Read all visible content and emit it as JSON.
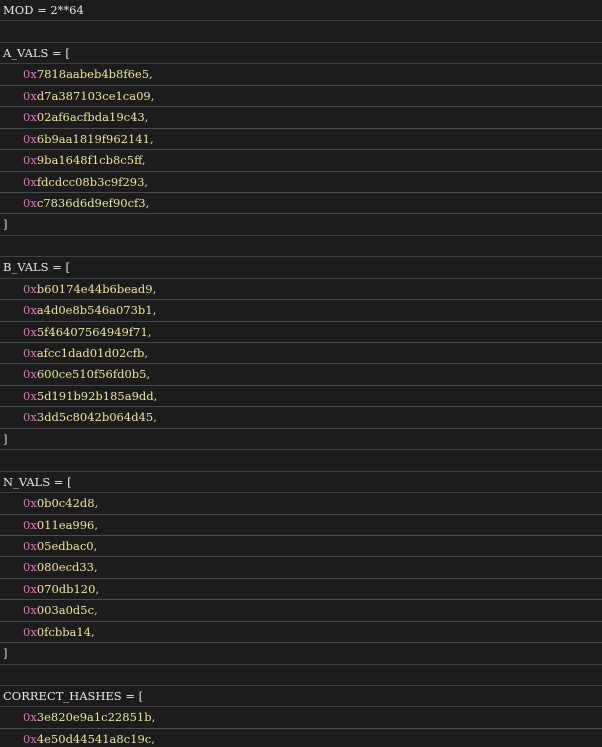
{
  "header": {
    "line": "MOD = 2**64"
  },
  "a_vals": {
    "open": "A_VALS = [",
    "items": [
      {
        "pre": "0x",
        "val": "7818aabeb4b8f6e5",
        "sep": ","
      },
      {
        "pre": "0x",
        "val": "d7a387103ce1ca09",
        "sep": ","
      },
      {
        "pre": "0x",
        "val": "02af6acfbda19c43",
        "sep": ","
      },
      {
        "pre": "0x",
        "val": "6b9aa1819f962141",
        "sep": ","
      },
      {
        "pre": "0x",
        "val": "9ba1648f1cb8c5ff",
        "sep": ","
      },
      {
        "pre": "0x",
        "val": "fdcdcc08b3c9f293",
        "sep": ","
      },
      {
        "pre": "0x",
        "val": "c7836d6d9ef90cf3",
        "sep": ","
      }
    ],
    "close": "]"
  },
  "b_vals": {
    "open": "B_VALS = [",
    "items": [
      {
        "pre": "0x",
        "val": "b60174e44b6bead9",
        "sep": ","
      },
      {
        "pre": "0x",
        "val": "a4d0e8b546a073b1",
        "sep": ","
      },
      {
        "pre": "0x",
        "val": "5f46407564949f71",
        "sep": ","
      },
      {
        "pre": "0x",
        "val": "afcc1dad01d02cfb",
        "sep": ","
      },
      {
        "pre": "0x",
        "val": "600ce510f56fd0b5",
        "sep": ","
      },
      {
        "pre": "0x",
        "val": "5d191b92b185a9dd",
        "sep": ","
      },
      {
        "pre": "0x",
        "val": "3dd5c8042b064d45",
        "sep": ","
      }
    ],
    "close": "]"
  },
  "n_vals": {
    "open": "N_VALS = [",
    "items": [
      {
        "pre": "0x",
        "val": "0b0c42d8",
        "sep": ","
      },
      {
        "pre": "0x",
        "val": "011ea996",
        "sep": ","
      },
      {
        "pre": "0x",
        "val": "05edbac0",
        "sep": ","
      },
      {
        "pre": "0x",
        "val": "080ecd33",
        "sep": ","
      },
      {
        "pre": "0x",
        "val": "070db120",
        "sep": ","
      },
      {
        "pre": "0x",
        "val": "003a0d5c",
        "sep": ","
      },
      {
        "pre": "0x",
        "val": "0fcbba14",
        "sep": ","
      }
    ],
    "close": "]"
  },
  "correct_hashes": {
    "open": "CORRECT_HASHES = [",
    "items": [
      {
        "pre": "0x",
        "val": "3e820e9a1c22851b",
        "sep": ","
      },
      {
        "pre": "0x",
        "val": "4e50d44541a8c19c",
        "sep": ","
      }
    ]
  },
  "colors": {
    "background": "#1c1c1c",
    "hex_prefix": "#e070b5",
    "hex_value": "#ede39a",
    "text": "#dcdcdc",
    "row_divider": "#3e3e3e"
  }
}
